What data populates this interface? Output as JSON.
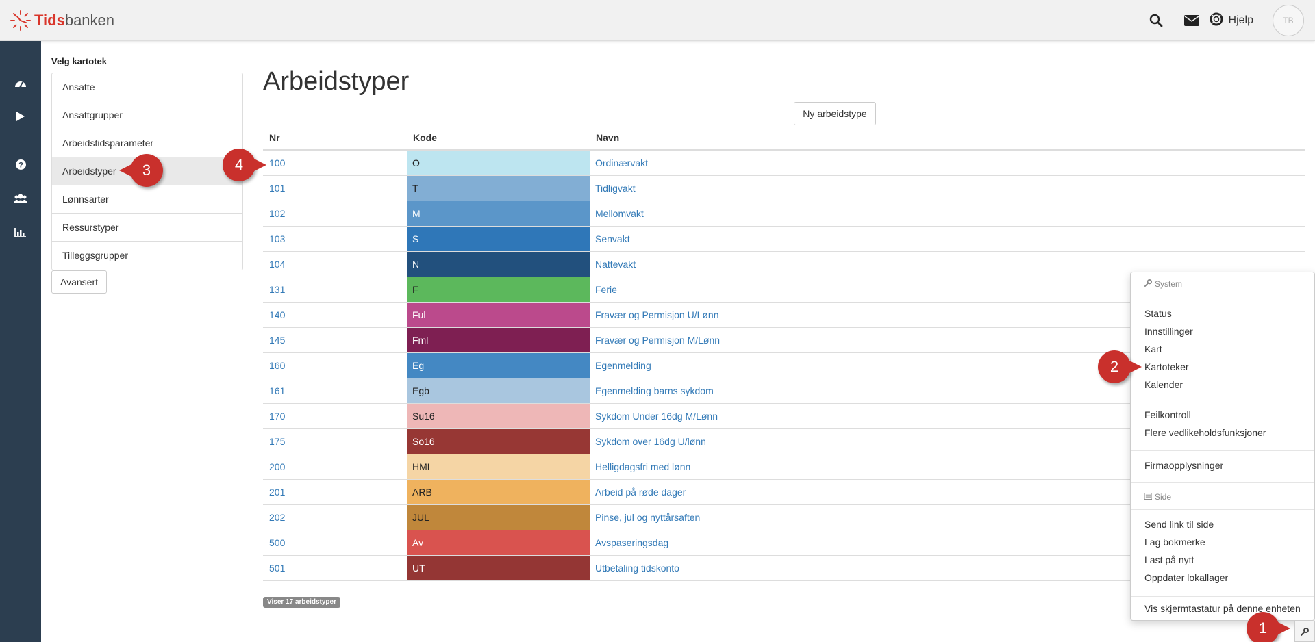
{
  "header": {
    "logo_bold": "Tids",
    "logo_rest": "banken",
    "help_label": "Hjelp",
    "avatar_initials": "TB"
  },
  "sidebar": {
    "title": "Velg kartotek",
    "items": [
      {
        "label": "Ansatte",
        "active": false
      },
      {
        "label": "Ansattgrupper",
        "active": false
      },
      {
        "label": "Arbeidstidsparameter",
        "active": false
      },
      {
        "label": "Arbeidstyper",
        "active": true
      },
      {
        "label": "Lønnsarter",
        "active": false
      },
      {
        "label": "Ressurstyper",
        "active": false
      },
      {
        "label": "Tilleggsgrupper",
        "active": false
      }
    ],
    "advanced_label": "Avansert"
  },
  "main": {
    "title": "Arbeidstyper",
    "new_button_label": "Ny arbeidstype",
    "columns": {
      "nr": "Nr",
      "kode": "Kode",
      "navn": "Navn"
    },
    "rows": [
      {
        "nr": "100",
        "kode": "O",
        "navn": "Ordinærvakt",
        "color": "#bde5f0",
        "text_color": "#222222"
      },
      {
        "nr": "101",
        "kode": "T",
        "navn": "Tidligvakt",
        "color": "#82aed4",
        "text_color": "#222222"
      },
      {
        "nr": "102",
        "kode": "M",
        "navn": "Mellomvakt",
        "color": "#5b96c9",
        "text_color": "#ffffff"
      },
      {
        "nr": "103",
        "kode": "S",
        "navn": "Senvakt",
        "color": "#2f77b8",
        "text_color": "#ffffff"
      },
      {
        "nr": "104",
        "kode": "N",
        "navn": "Nattevakt",
        "color": "#22507d",
        "text_color": "#ffffff"
      },
      {
        "nr": "131",
        "kode": "F",
        "navn": "Ferie",
        "color": "#5cb85c",
        "text_color": "#222222"
      },
      {
        "nr": "140",
        "kode": "Ful",
        "navn": "Fravær og Permisjon U/Lønn",
        "color": "#bb4a8c",
        "text_color": "#ffffff"
      },
      {
        "nr": "145",
        "kode": "Fml",
        "navn": "Fravær og Permisjon M/Lønn",
        "color": "#7e1f52",
        "text_color": "#ffffff"
      },
      {
        "nr": "160",
        "kode": "Eg",
        "navn": "Egenmelding",
        "color": "#4488c3",
        "text_color": "#ffffff"
      },
      {
        "nr": "161",
        "kode": "Egb",
        "navn": "Egenmelding barns sykdom",
        "color": "#a9c6df",
        "text_color": "#222222"
      },
      {
        "nr": "170",
        "kode": "Su16",
        "navn": "Sykdom Under 16dg M/Lønn",
        "color": "#eeb7b7",
        "text_color": "#222222"
      },
      {
        "nr": "175",
        "kode": "So16",
        "navn": "Sykdom over 16dg U/lønn",
        "color": "#973734",
        "text_color": "#ffffff"
      },
      {
        "nr": "200",
        "kode": "HML",
        "navn": "Helligdagsfri med lønn",
        "color": "#f5d5a5",
        "text_color": "#222222"
      },
      {
        "nr": "201",
        "kode": "ARB",
        "navn": "Arbeid på røde dager",
        "color": "#efb25e",
        "text_color": "#222222"
      },
      {
        "nr": "202",
        "kode": "JUL",
        "navn": "Pinse, jul og nyttårsaften",
        "color": "#c0873b",
        "text_color": "#222222"
      },
      {
        "nr": "500",
        "kode": "Av",
        "navn": "Avspaseringsdag",
        "color": "#d9534f",
        "text_color": "#ffffff"
      },
      {
        "nr": "501",
        "kode": "UT",
        "navn": "Utbetaling tidskonto",
        "color": "#943634",
        "text_color": "#ffffff"
      }
    ],
    "count_badge": "Viser 17 arbeidstyper"
  },
  "menu": {
    "system_header": "System",
    "system_items": [
      "Status",
      "Innstillinger",
      "Kart",
      "Kartoteker",
      "Kalender"
    ],
    "group2": [
      "Feilkontroll",
      "Flere vedlikeholdsfunksjoner"
    ],
    "group3": [
      "Firmaopplysninger"
    ],
    "side_header": "Side",
    "side_items": [
      "Send link til side",
      "Lag bokmerke",
      "Last på nytt",
      "Oppdater lokallager"
    ],
    "last_item": "Vis skjermtastatur på denne enheten"
  },
  "callouts": [
    "1",
    "2",
    "3",
    "4"
  ],
  "icons": {
    "top": [
      "search-icon",
      "envelope-icon",
      "lifering-icon"
    ],
    "nav": [
      "dashboard-icon",
      "play-icon",
      "question-icon",
      "users-icon",
      "bar-chart-icon"
    ]
  }
}
